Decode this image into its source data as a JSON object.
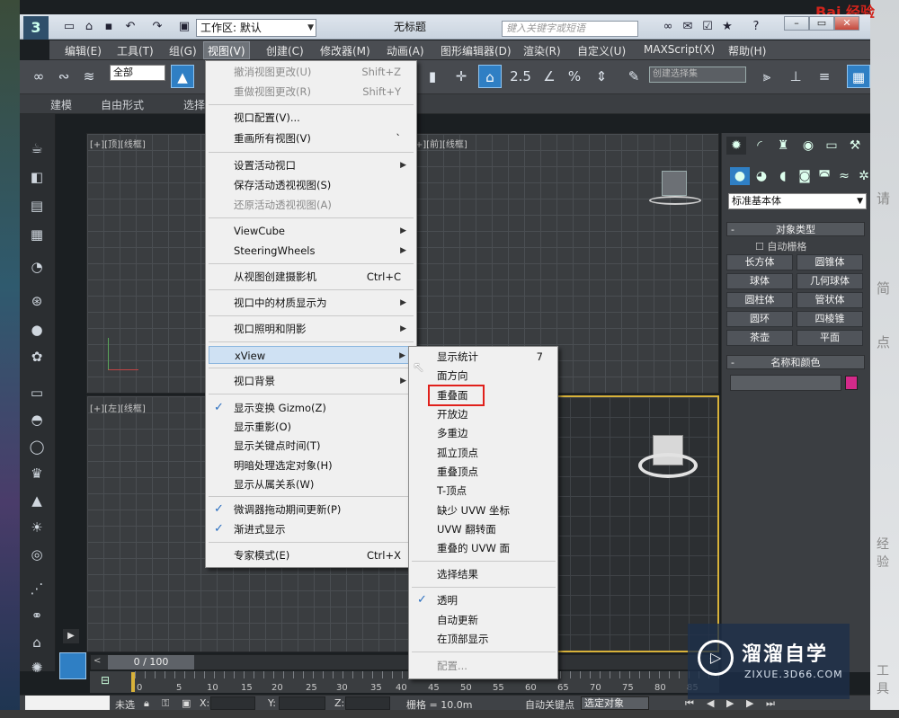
{
  "window": {
    "title": "无标题",
    "workspace_label": "工作区: 默认",
    "search_placeholder": "键入关键字或短语"
  },
  "menubar": {
    "items": [
      "编辑(E)",
      "工具(T)",
      "组(G)",
      "视图(V)",
      "创建(C)",
      "修改器(M)",
      "动画(A)",
      "图形编辑器(D)",
      "渲染(R)",
      "自定义(U)",
      "MAXScript(X)",
      "帮助(H)"
    ]
  },
  "toolbar": {
    "selection_filter": "全部",
    "named_selection": "创建选择集",
    "snap_angle": "2.5",
    "snap_percent": "%"
  },
  "ribbon": {
    "tabs": [
      "建模",
      "自由形式",
      "选择"
    ]
  },
  "viewports": {
    "top_left_label": "[+][顶][线框]",
    "top_right_label": "[+][前][线框]",
    "bottom_left_label": "[+][左][线框]"
  },
  "view_menu": {
    "items": [
      {
        "label": "撤消视图更改(U)",
        "shortcut": "Shift+Z",
        "disabled": true
      },
      {
        "label": "重做视图更改(R)",
        "shortcut": "Shift+Y",
        "disabled": true
      },
      {
        "label": "视口配置(V)..."
      },
      {
        "label": "重画所有视图(V)",
        "shortcut": "`"
      },
      {
        "label": "设置活动视口",
        "submenu": true
      },
      {
        "label": "保存活动透视视图(S)"
      },
      {
        "label": "还原活动透视视图(A)",
        "disabled": true
      },
      {
        "label": "ViewCube",
        "submenu": true
      },
      {
        "label": "SteeringWheels",
        "submenu": true
      },
      {
        "label": "从视图创建摄影机",
        "shortcut": "Ctrl+C"
      },
      {
        "label": "视口中的材质显示为",
        "submenu": true
      },
      {
        "label": "视口照明和阴影",
        "submenu": true
      },
      {
        "label": "xView",
        "submenu": true,
        "highlighted": true
      },
      {
        "label": "视口背景",
        "submenu": true
      },
      {
        "label": "显示变换 Gizmo(Z)",
        "checked": true
      },
      {
        "label": "显示重影(O)"
      },
      {
        "label": "显示关键点时间(T)"
      },
      {
        "label": "明暗处理选定对象(H)"
      },
      {
        "label": "显示从属关系(W)"
      },
      {
        "label": "微调器拖动期间更新(P)",
        "checked": true
      },
      {
        "label": "渐进式显示",
        "checked": true
      },
      {
        "label": "专家模式(E)",
        "shortcut": "Ctrl+X"
      }
    ]
  },
  "xview_submenu": {
    "items": [
      {
        "label": "显示统计",
        "shortcut": "7"
      },
      {
        "label": "面方向"
      },
      {
        "label": "重叠面",
        "boxed": true
      },
      {
        "label": "开放边"
      },
      {
        "label": "多重边"
      },
      {
        "label": "孤立顶点"
      },
      {
        "label": "重叠顶点"
      },
      {
        "label": "T-顶点"
      },
      {
        "label": "缺少 UVW 坐标"
      },
      {
        "label": "UVW 翻转面"
      },
      {
        "label": "重叠的 UVW 面"
      },
      {
        "label": "选择结果"
      },
      {
        "label": "透明",
        "checked": true
      },
      {
        "label": "自动更新"
      },
      {
        "label": "在顶部显示"
      },
      {
        "label": "配置...",
        "disabled": true
      }
    ],
    "highlight_color": "#e0201b"
  },
  "command_panel": {
    "category": "标准基本体",
    "object_type_header": "对象类型",
    "autogrid": "自动栅格",
    "primitives": [
      "长方体",
      "圆锥体",
      "球体",
      "几何球体",
      "圆柱体",
      "管状体",
      "圆环",
      "四棱锥",
      "茶壶",
      "平面"
    ],
    "name_color_header": "名称和颜色",
    "object_color": "#d42a8a"
  },
  "timeline": {
    "slider_label": "0 / 100",
    "ticks": [
      "0",
      "5",
      "10",
      "15",
      "20",
      "25",
      "30",
      "35",
      "40",
      "45",
      "50",
      "55",
      "60",
      "65",
      "70",
      "75",
      "80",
      "85"
    ]
  },
  "statusbar": {
    "selection": "未选",
    "x_label": "X:",
    "y_label": "Y:",
    "z_label": "Z:",
    "grid": "栅格 = 10.0m",
    "auto_key": "自动关键点",
    "selected_object": "选定对象"
  },
  "watermark": {
    "title": "溜溜自学",
    "subtitle": "ZIXUE.3D66.COM"
  },
  "background_text": {
    "baidu": "Bai 经验",
    "right_texts": [
      "请",
      "简",
      "点",
      "经验",
      "工具"
    ]
  }
}
